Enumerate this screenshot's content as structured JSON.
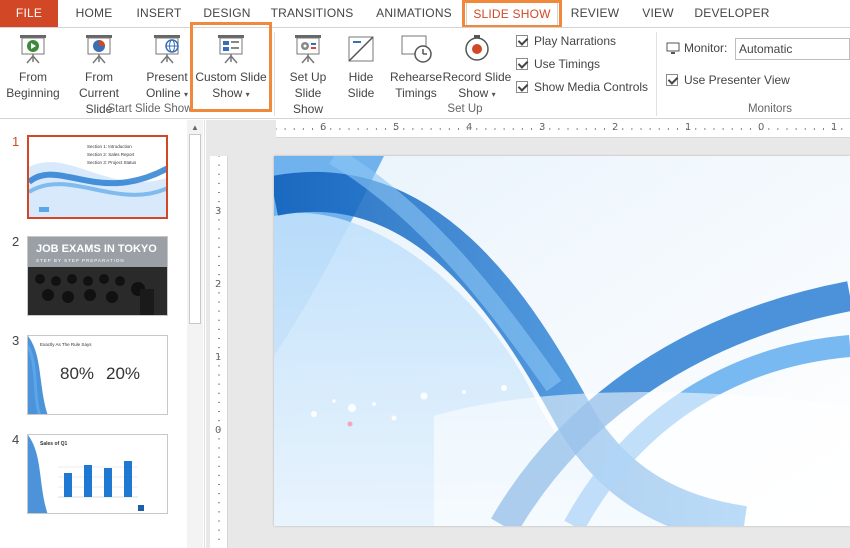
{
  "tabs": [
    {
      "label": "FILE"
    },
    {
      "label": "HOME"
    },
    {
      "label": "INSERT"
    },
    {
      "label": "DESIGN"
    },
    {
      "label": "TRANSITIONS"
    },
    {
      "label": "ANIMATIONS"
    },
    {
      "label": "SLIDE SHOW",
      "active": true
    },
    {
      "label": "REVIEW"
    },
    {
      "label": "VIEW"
    },
    {
      "label": "DEVELOPER"
    }
  ],
  "ribbon": {
    "start_group": {
      "label": "Start Slide Show",
      "from_beginning": {
        "line1": "From",
        "line2": "Beginning"
      },
      "from_current": {
        "line1": "From",
        "line2": "Current Slide"
      },
      "present_online": {
        "line1": "Present",
        "line2": "Online"
      },
      "custom_show": {
        "line1": "Custom Slide",
        "line2": "Show"
      }
    },
    "setup_group": {
      "label": "Set Up",
      "setup_show": {
        "line1": "Set Up",
        "line2": "Slide Show"
      },
      "hide_slide": {
        "line1": "Hide",
        "line2": "Slide"
      },
      "rehearse": {
        "line1": "Rehearse",
        "line2": "Timings"
      },
      "record": {
        "line1": "Record Slide",
        "line2": "Show"
      },
      "play_narrations": "Play Narrations",
      "use_timings": "Use Timings",
      "show_media_controls": "Show Media Controls"
    },
    "monitors_group": {
      "label": "Monitors",
      "monitor_label": "Monitor:",
      "monitor_value": "Automatic",
      "presenter_view": "Use Presenter View"
    }
  },
  "slides": [
    {
      "number": "1",
      "lines": [
        "Section 1: Introduction",
        "Section 2: Sales Report",
        "Section 3: Project Status"
      ]
    },
    {
      "number": "2",
      "title": "JOB EXAMS IN TOKYO",
      "subtitle": "STEP BY STEP PREPARATION"
    },
    {
      "number": "3",
      "heading": "Exactly As The Rule Says",
      "value1": "80%",
      "value2": "20%"
    },
    {
      "number": "4",
      "title": "Sales of Q1"
    }
  ],
  "ruler": {
    "h_labels": [
      "6",
      "5",
      "4",
      "3",
      "2",
      "1",
      "0",
      "1"
    ],
    "v_labels": [
      "3",
      "2",
      "1",
      "0"
    ]
  },
  "colors": {
    "accent": "#d24726",
    "highlight": "#f0893b",
    "wave_blue": "#1f78d1"
  }
}
